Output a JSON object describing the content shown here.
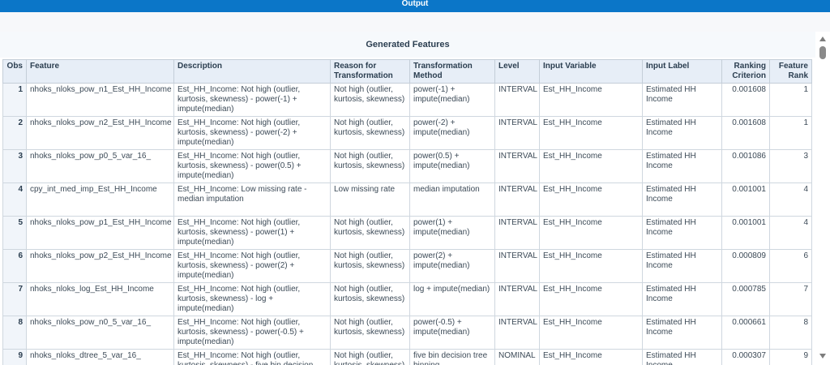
{
  "output_title": "Output",
  "caption": "Generated Features",
  "columns": [
    "Obs",
    "Feature",
    "Description",
    "Reason for Transformation",
    "Transformation Method",
    "Level",
    "Input Variable",
    "Input Label",
    "Ranking Criterion",
    "Feature Rank"
  ],
  "rows": [
    {
      "obs": "1",
      "feature": "nhoks_nloks_pow_n1_Est_HH_Income",
      "description": "Est_HH_Income: Not high (outlier, kurtosis, skewness) - power(-1) + impute(median)",
      "reason": "Not high (outlier, kurtosis, skewness)",
      "method": "power(-1) + impute(median)",
      "level": "INTERVAL",
      "input_variable": "Est_HH_Income",
      "input_label": "Estimated HH Income",
      "ranking": "0.001608",
      "rank": "1"
    },
    {
      "obs": "2",
      "feature": "nhoks_nloks_pow_n2_Est_HH_Income",
      "description": "Est_HH_Income: Not high (outlier, kurtosis, skewness) - power(-2) + impute(median)",
      "reason": "Not high (outlier, kurtosis, skewness)",
      "method": "power(-2) + impute(median)",
      "level": "INTERVAL",
      "input_variable": "Est_HH_Income",
      "input_label": "Estimated HH Income",
      "ranking": "0.001608",
      "rank": "1"
    },
    {
      "obs": "3",
      "feature": "nhoks_nloks_pow_p0_5_var_16_",
      "description": "Est_HH_Income: Not high (outlier, kurtosis, skewness) - power(0.5) + impute(median)",
      "reason": "Not high (outlier, kurtosis, skewness)",
      "method": "power(0.5) + impute(median)",
      "level": "INTERVAL",
      "input_variable": "Est_HH_Income",
      "input_label": "Estimated HH Income",
      "ranking": "0.001086",
      "rank": "3"
    },
    {
      "obs": "4",
      "feature": "cpy_int_med_imp_Est_HH_Income",
      "description": "Est_HH_Income: Low missing rate - median imputation",
      "reason": "Low missing rate",
      "method": "median imputation",
      "level": "INTERVAL",
      "input_variable": "Est_HH_Income",
      "input_label": "Estimated HH Income",
      "ranking": "0.001001",
      "rank": "4"
    },
    {
      "obs": "5",
      "feature": "nhoks_nloks_pow_p1_Est_HH_Income",
      "description": "Est_HH_Income: Not high (outlier, kurtosis, skewness) - power(1) + impute(median)",
      "reason": "Not high (outlier, kurtosis, skewness)",
      "method": "power(1) + impute(median)",
      "level": "INTERVAL",
      "input_variable": "Est_HH_Income",
      "input_label": "Estimated HH Income",
      "ranking": "0.001001",
      "rank": "4"
    },
    {
      "obs": "6",
      "feature": "nhoks_nloks_pow_p2_Est_HH_Income",
      "description": "Est_HH_Income: Not high (outlier, kurtosis, skewness) - power(2) + impute(median)",
      "reason": "Not high (outlier, kurtosis, skewness)",
      "method": "power(2) + impute(median)",
      "level": "INTERVAL",
      "input_variable": "Est_HH_Income",
      "input_label": "Estimated HH Income",
      "ranking": "0.000809",
      "rank": "6"
    },
    {
      "obs": "7",
      "feature": "nhoks_nloks_log_Est_HH_Income",
      "description": "Est_HH_Income: Not high (outlier, kurtosis, skewness) - log + impute(median)",
      "reason": "Not high (outlier, kurtosis, skewness)",
      "method": "log + impute(median)",
      "level": "INTERVAL",
      "input_variable": "Est_HH_Income",
      "input_label": "Estimated HH Income",
      "ranking": "0.000785",
      "rank": "7"
    },
    {
      "obs": "8",
      "feature": "nhoks_nloks_pow_n0_5_var_16_",
      "description": "Est_HH_Income: Not high (outlier, kurtosis, skewness) - power(-0.5) + impute(median)",
      "reason": "Not high (outlier, kurtosis, skewness)",
      "method": "power(-0.5) + impute(median)",
      "level": "INTERVAL",
      "input_variable": "Est_HH_Income",
      "input_label": "Estimated HH Income",
      "ranking": "0.000661",
      "rank": "8"
    },
    {
      "obs": "9",
      "feature": "nhoks_nloks_dtree_5_var_16_",
      "description": "Est_HH_Income: Not high (outlier, kurtosis, skewness) - five bin decision tree binning",
      "reason": "Not high (outlier, kurtosis, skewness)",
      "method": "five bin decision tree binning",
      "level": "NOMINAL",
      "input_variable": "Est_HH_Income",
      "input_label": "Estimated HH Income",
      "ranking": "0.000307",
      "rank": "9"
    }
  ]
}
